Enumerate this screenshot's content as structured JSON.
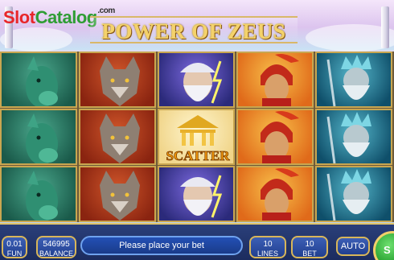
{
  "header": {
    "site_logo_part1": "Slot",
    "site_logo_part2": "Catalog",
    "site_logo_suffix": ".com",
    "game_title": "POWER OF ZEUS"
  },
  "reels": {
    "columns": [
      [
        "horse",
        "horse",
        "horse"
      ],
      [
        "wolf",
        "wolf",
        "wolf"
      ],
      [
        "zeus",
        "scatter",
        "zeus"
      ],
      [
        "spartan",
        "spartan",
        "spartan"
      ],
      [
        "poseidon",
        "poseidon",
        "poseidon"
      ]
    ],
    "scatter_label": "SCATTER"
  },
  "bottom": {
    "coin_value": "0.01",
    "coin_label": "FUN",
    "balance_value": "546995",
    "balance_label": "BALANCE",
    "message": "Please place your bet",
    "lines_value": "10",
    "lines_label": "LINES",
    "bet_value": "10",
    "bet_label": "BET",
    "auto_label": "AUTO",
    "spin_label": "S"
  },
  "colors": {
    "frame_gold": "#c9a650",
    "bar_blue": "#1c2c5e",
    "spin_green": "#1f9a2a",
    "logo_red": "#e8262a",
    "logo_green": "#2f9d34"
  }
}
